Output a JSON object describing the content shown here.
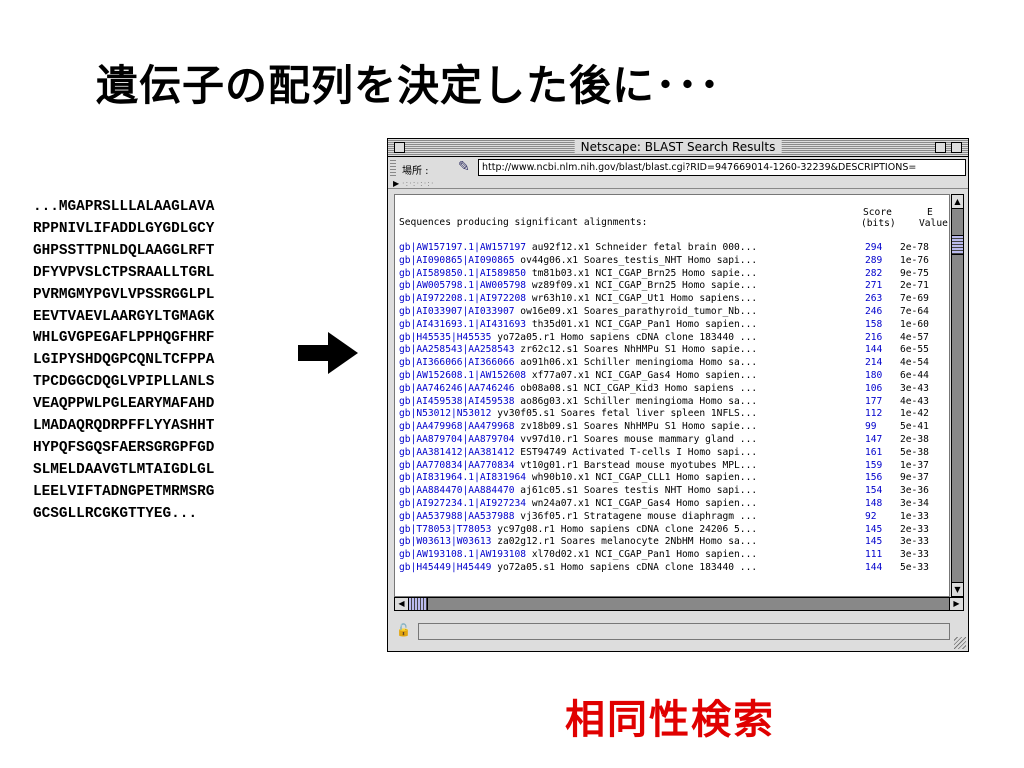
{
  "slide": {
    "title": "遺伝子の配列を決定した後に･･･",
    "caption": "相同性検索",
    "caption_color": "#e00000",
    "sequence_lines": [
      "...MGAPRSLLLALAAGLAVA",
      "RPPNIVLIFADDLGYGDLGCY",
      "GHPSSTTPNLDQLAAGGLRFT",
      "DFYVPVSLCTPSRAALLTGRL",
      "PVRMGMYPGVLVPSSRGGLPL",
      "EEVTVAEVLAARGYLTGMAGK",
      "WHLGVGPEGAFLPPHQGFHRF",
      "LGIPYSHDQGPCQNLTCFPPA",
      "TPCDGGCDQGLVPIPLLANLS",
      "VEAQPPWLPGLEARYMAFAHD",
      "LMADAQRQDRPFFLYYASHHT",
      "HYPQFSGQSFAERSGRGPFGD",
      "SLMELDAAVGTLMTAIGDLGL",
      "LEELVIFTADNGPETMRMSRG",
      "GCSGLLRCGKGTTYEG..."
    ],
    "arrow_icon": "right-arrow-icon"
  },
  "window": {
    "title": "Netscape: BLAST Search Results",
    "location_label": "場所 :",
    "url": "http://www.ncbi.nlm.nih.gov/blast/blast.cgi?RID=947669014-1260-32239&DESCRIPTIONS=",
    "header": {
      "left": "Sequences producing significant alignments:",
      "score_line1": "Score",
      "score_line2": "(bits)",
      "e_line1": "E",
      "e_line2": "Value"
    },
    "rows": [
      {
        "acc": "gb|AW157197.1|AW157197",
        "desc": "  au92f12.x1 Schneider fetal brain 000...",
        "score": "294",
        "evalue": "2e-78"
      },
      {
        "acc": "gb|AI090865|AI090865",
        "desc": "  ov44g06.x1 Soares_testis_NHT Homo sapi...",
        "score": "289",
        "evalue": "1e-76"
      },
      {
        "acc": "gb|AI589850.1|AI589850",
        "desc": "  tm81b03.x1 NCI_CGAP_Brn25 Homo sapie...",
        "score": "282",
        "evalue": "9e-75"
      },
      {
        "acc": "gb|AW005798.1|AW005798",
        "desc": "  wz89f09.x1 NCI_CGAP_Brn25 Homo sapie...",
        "score": "271",
        "evalue": "2e-71"
      },
      {
        "acc": "gb|AI972208.1|AI972208",
        "desc": "  wr63h10.x1 NCI_CGAP_Ut1 Homo sapiens...",
        "score": "263",
        "evalue": "7e-69"
      },
      {
        "acc": "gb|AI033907|AI033907",
        "desc": "  ow16e09.x1 Soares_parathyroid_tumor_Nb...",
        "score": "246",
        "evalue": "7e-64"
      },
      {
        "acc": "gb|AI431693.1|AI431693",
        "desc": "  th35d01.x1 NCI_CGAP_Pan1 Homo sapien...",
        "score": "158",
        "evalue": "1e-60"
      },
      {
        "acc": "gb|H45535|H45535",
        "desc": "  yo72a05.r1 Homo sapiens cDNA clone 183440 ...",
        "score": "216",
        "evalue": "4e-57"
      },
      {
        "acc": "gb|AA258543|AA258543",
        "desc": "  zr62c12.s1 Soares NhHMPu S1 Homo sapie...",
        "score": "144",
        "evalue": "6e-55"
      },
      {
        "acc": "gb|AI366066|AI366066",
        "desc": "  ao91h06.x1 Schiller meningioma Homo sa...",
        "score": "214",
        "evalue": "4e-54"
      },
      {
        "acc": "gb|AW152608.1|AW152608",
        "desc": "  xf77a07.x1 NCI_CGAP_Gas4 Homo sapien...",
        "score": "180",
        "evalue": "6e-44"
      },
      {
        "acc": "gb|AA746246|AA746246",
        "desc": "  ob08a08.s1 NCI_CGAP_Kid3 Homo sapiens ...",
        "score": "106",
        "evalue": "3e-43"
      },
      {
        "acc": "gb|AI459538|AI459538",
        "desc": "  ao86g03.x1 Schiller meningioma Homo sa...",
        "score": "177",
        "evalue": "4e-43"
      },
      {
        "acc": "gb|N53012|N53012",
        "desc": "  yv30f05.s1 Soares fetal liver spleen 1NFLS...",
        "score": "112",
        "evalue": "1e-42"
      },
      {
        "acc": "gb|AA479968|AA479968",
        "desc": "  zv18b09.s1 Soares NhHMPu S1 Homo sapie...",
        "score": "99",
        "evalue": "5e-41"
      },
      {
        "acc": "gb|AA879704|AA879704",
        "desc": "  vv97d10.r1 Soares mouse mammary gland ...",
        "score": "147",
        "evalue": "2e-38"
      },
      {
        "acc": "gb|AA381412|AA381412",
        "desc": "  EST94749 Activated T-cells I Homo sapi...",
        "score": "161",
        "evalue": "5e-38"
      },
      {
        "acc": "gb|AA770834|AA770834",
        "desc": "  vt10g01.r1 Barstead mouse myotubes MPL...",
        "score": "159",
        "evalue": "1e-37"
      },
      {
        "acc": "gb|AI831964.1|AI831964",
        "desc": "  wh90b10.x1 NCI_CGAP_CLL1 Homo sapien...",
        "score": "156",
        "evalue": "9e-37"
      },
      {
        "acc": "gb|AA884470|AA884470",
        "desc": "  aj61c05.s1 Soares testis NHT Homo sapi...",
        "score": "154",
        "evalue": "3e-36"
      },
      {
        "acc": "gb|AI927234.1|AI927234",
        "desc": "  wn24a07.x1 NCI_CGAP_Gas4 Homo sapien...",
        "score": "148",
        "evalue": "3e-34"
      },
      {
        "acc": "gb|AA537988|AA537988",
        "desc": "  vj36f05.r1 Stratagene mouse diaphragm ...",
        "score": "92",
        "evalue": "1e-33"
      },
      {
        "acc": "gb|T78053|T78053",
        "desc": "  yc97g08.r1 Homo sapiens cDNA clone 24206 5...",
        "score": "145",
        "evalue": "2e-33"
      },
      {
        "acc": "gb|W03613|W03613",
        "desc": "  za02g12.r1 Soares melanocyte 2NbHM Homo sa...",
        "score": "145",
        "evalue": "3e-33"
      },
      {
        "acc": "gb|AW193108.1|AW193108",
        "desc": "  xl70d02.x1 NCI_CGAP_Pan1 Homo sapien...",
        "score": "111",
        "evalue": "3e-33"
      },
      {
        "acc": "gb|H45449|H45449",
        "desc": "  yo72a05.s1 Homo sapiens cDNA clone 183440 ...",
        "score": "144",
        "evalue": "5e-33"
      }
    ]
  }
}
